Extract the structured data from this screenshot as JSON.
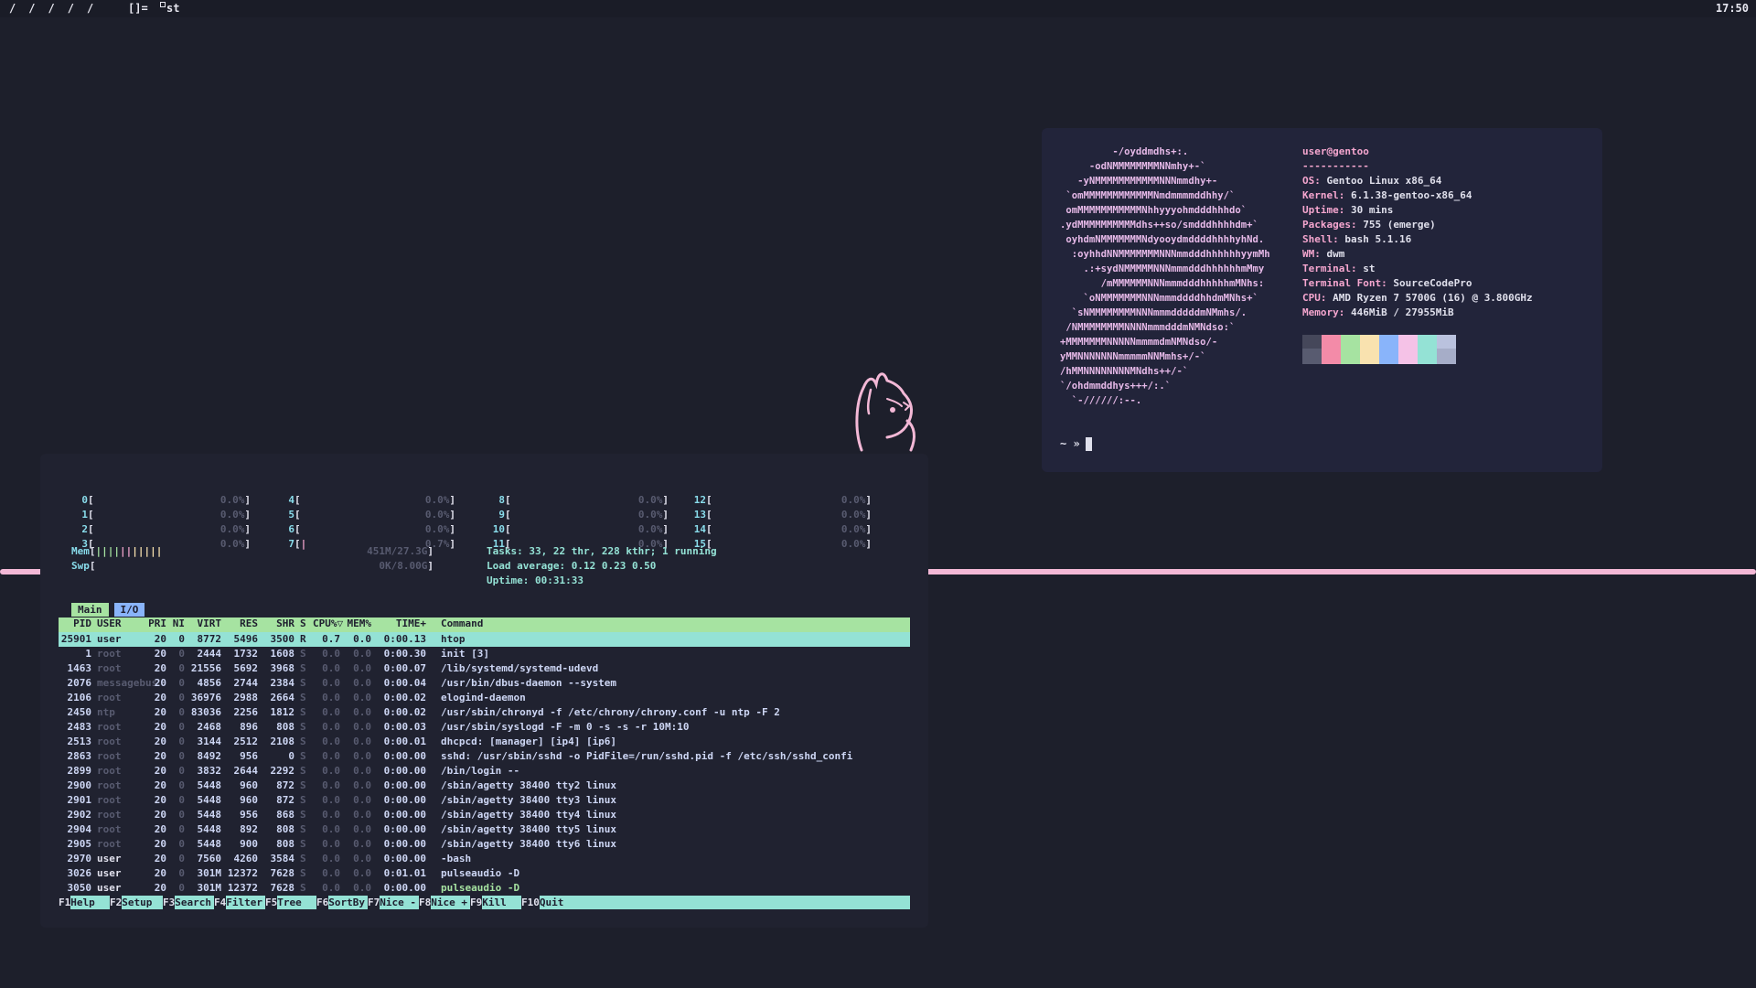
{
  "bar": {
    "tags": [
      "/",
      "/",
      "/",
      "/",
      "/"
    ],
    "layout": "[]=",
    "window_title": "st",
    "clock": "17:50"
  },
  "neofetch": {
    "ascii": [
      "         -/oyddmdhs+:.",
      "     -odNMMMMMMMMNNmhy+-`",
      "   -yNMMMMMMMMMMMNNNmmdhy+-",
      " `omMMMMMMMMMMMMNmdmmmmddhhy/`",
      " omMMMMMMMMMMMNhhyyyohmdddhhhdo`",
      ".ydMMMMMMMMMMdhs++so/smdddhhhhdm+`",
      " oyhdmNMMMMMMMNdyooydmddddhhhhyhNd.",
      "  :oyhhdNNMMMMMMMNNNmmdddhhhhhhyymMh",
      "    .:+sydNMMMMMNNNmmmdddhhhhhhmMmy",
      "       /mMMMMMMNNNmmmdddhhhhhmMNhs:",
      "    `oNMMMMMMMNNNmmmddddhhdmMNhs+`",
      "  `sNMMMMMMMMNNNmmmdddddmNMmhs/.",
      " /NMMMMMMMMNNNNmmmdddmNMNdso:`",
      "+MMMMMMMNNNNNmmmmdmNMNdso/-",
      "yMMNNNNNNNmmmmmNNMmhs+/-`",
      "/hMMNNNNNNNNMNdhs++/-`",
      "`/ohdmmddhys+++/:.`",
      "  `-//////:--."
    ],
    "info": [
      {
        "key": "user@gentoo",
        "value": ""
      },
      {
        "key": "-----------",
        "value": ""
      },
      {
        "key": "OS: ",
        "value": "Gentoo Linux x86_64"
      },
      {
        "key": "Kernel: ",
        "value": "6.1.38-gentoo-x86_64"
      },
      {
        "key": "Uptime: ",
        "value": "30 mins"
      },
      {
        "key": "Packages: ",
        "value": "755 (emerge)"
      },
      {
        "key": "Shell: ",
        "value": "bash 5.1.16"
      },
      {
        "key": "WM: ",
        "value": "dwm"
      },
      {
        "key": "Terminal: ",
        "value": "st"
      },
      {
        "key": "Terminal Font: ",
        "value": "SourceCodePro"
      },
      {
        "key": "CPU: ",
        "value": "AMD Ryzen 7 5700G (16) @ 3.800GHz"
      },
      {
        "key": "Memory: ",
        "value": "446MiB / 27955MiB"
      }
    ],
    "palette": [
      {
        "top": "#45475a",
        "bottom": "#585b70"
      },
      {
        "top": "#f38ba8",
        "bottom": "#f38ba8"
      },
      {
        "top": "#a6e3a1",
        "bottom": "#a6e3a1"
      },
      {
        "top": "#f9e2af",
        "bottom": "#f9e2af"
      },
      {
        "top": "#89b4fa",
        "bottom": "#89b4fa"
      },
      {
        "top": "#f5c2e7",
        "bottom": "#f5c2e7"
      },
      {
        "top": "#94e2d5",
        "bottom": "#94e2d5"
      },
      {
        "top": "#bac2de",
        "bottom": "#a6adc8"
      }
    ],
    "prompt": "~ »"
  },
  "htop": {
    "cpus": [
      {
        "id": "0",
        "pct": "0.0%"
      },
      {
        "id": "1",
        "pct": "0.0%"
      },
      {
        "id": "2",
        "pct": "0.0%"
      },
      {
        "id": "3",
        "pct": "0.0%"
      },
      {
        "id": "4",
        "pct": "0.0%"
      },
      {
        "id": "5",
        "pct": "0.0%"
      },
      {
        "id": "6",
        "pct": "0.0%"
      },
      {
        "id": "7",
        "pct": "0.7%"
      },
      {
        "id": "8",
        "pct": "0.0%"
      },
      {
        "id": "9",
        "pct": "0.0%"
      },
      {
        "id": "10",
        "pct": "0.0%"
      },
      {
        "id": "11",
        "pct": "0.0%"
      },
      {
        "id": "12",
        "pct": "0.0%"
      },
      {
        "id": "13",
        "pct": "0.0%"
      },
      {
        "id": "14",
        "pct": "0.0%"
      },
      {
        "id": "15",
        "pct": "0.0%"
      }
    ],
    "mem_label": "Mem",
    "mem_value": "451M/27.3G",
    "swp_label": "Swp",
    "swp_value": "0K/8.00G",
    "tasks": "Tasks: 33, 22 thr, 228 kthr; 1 running",
    "load": "Load average: 0.12 0.23 0.50",
    "uptime": "Uptime: 00:31:33",
    "tab_main": "Main",
    "tab_io": "I/O",
    "columns": [
      "PID",
      "USER",
      "PRI",
      "NI",
      "VIRT",
      "RES",
      "SHR",
      "S",
      "CPU%▽",
      "MEM%",
      "TIME+",
      "Command"
    ],
    "processes": [
      {
        "pid": "25901",
        "user": "user",
        "pri": "20",
        "ni": "0",
        "virt": "8772",
        "res": "5496",
        "shr": "3500",
        "s": "R",
        "cpu": "0.7",
        "mem": "0.0",
        "time": "0:00.13",
        "cmd": "htop"
      },
      {
        "pid": "1",
        "user": "root",
        "pri": "20",
        "ni": "0",
        "virt": "2444",
        "res": "1732",
        "shr": "1608",
        "s": "S",
        "cpu": "0.0",
        "mem": "0.0",
        "time": "0:00.30",
        "cmd": "init [3]"
      },
      {
        "pid": "1463",
        "user": "root",
        "pri": "20",
        "ni": "0",
        "virt": "21556",
        "res": "5692",
        "shr": "3968",
        "s": "S",
        "cpu": "0.0",
        "mem": "0.0",
        "time": "0:00.07",
        "cmd": "/lib/systemd/systemd-udevd"
      },
      {
        "pid": "2076",
        "user": "messagebus",
        "pri": "20",
        "ni": "0",
        "virt": "4856",
        "res": "2744",
        "shr": "2384",
        "s": "S",
        "cpu": "0.0",
        "mem": "0.0",
        "time": "0:00.04",
        "cmd": "/usr/bin/dbus-daemon --system"
      },
      {
        "pid": "2106",
        "user": "root",
        "pri": "20",
        "ni": "0",
        "virt": "36976",
        "res": "2988",
        "shr": "2664",
        "s": "S",
        "cpu": "0.0",
        "mem": "0.0",
        "time": "0:00.02",
        "cmd": "elogind-daemon"
      },
      {
        "pid": "2450",
        "user": "ntp",
        "pri": "20",
        "ni": "0",
        "virt": "83036",
        "res": "2256",
        "shr": "1812",
        "s": "S",
        "cpu": "0.0",
        "mem": "0.0",
        "time": "0:00.02",
        "cmd": "/usr/sbin/chronyd -f /etc/chrony/chrony.conf -u ntp -F 2"
      },
      {
        "pid": "2483",
        "user": "root",
        "pri": "20",
        "ni": "0",
        "virt": "2468",
        "res": "896",
        "shr": "808",
        "s": "S",
        "cpu": "0.0",
        "mem": "0.0",
        "time": "0:00.03",
        "cmd": "/usr/sbin/syslogd -F -m 0 -s -s -r 10M:10"
      },
      {
        "pid": "2513",
        "user": "root",
        "pri": "20",
        "ni": "0",
        "virt": "3144",
        "res": "2512",
        "shr": "2108",
        "s": "S",
        "cpu": "0.0",
        "mem": "0.0",
        "time": "0:00.01",
        "cmd": "dhcpcd: [manager] [ip4] [ip6]"
      },
      {
        "pid": "2863",
        "user": "root",
        "pri": "20",
        "ni": "0",
        "virt": "8492",
        "res": "956",
        "shr": "0",
        "s": "S",
        "cpu": "0.0",
        "mem": "0.0",
        "time": "0:00.00",
        "cmd": "sshd: /usr/sbin/sshd -o PidFile=/run/sshd.pid -f /etc/ssh/sshd_confi"
      },
      {
        "pid": "2899",
        "user": "root",
        "pri": "20",
        "ni": "0",
        "virt": "3832",
        "res": "2644",
        "shr": "2292",
        "s": "S",
        "cpu": "0.0",
        "mem": "0.0",
        "time": "0:00.00",
        "cmd": "/bin/login --"
      },
      {
        "pid": "2900",
        "user": "root",
        "pri": "20",
        "ni": "0",
        "virt": "5448",
        "res": "960",
        "shr": "872",
        "s": "S",
        "cpu": "0.0",
        "mem": "0.0",
        "time": "0:00.00",
        "cmd": "/sbin/agetty 38400 tty2 linux"
      },
      {
        "pid": "2901",
        "user": "root",
        "pri": "20",
        "ni": "0",
        "virt": "5448",
        "res": "960",
        "shr": "872",
        "s": "S",
        "cpu": "0.0",
        "mem": "0.0",
        "time": "0:00.00",
        "cmd": "/sbin/agetty 38400 tty3 linux"
      },
      {
        "pid": "2902",
        "user": "root",
        "pri": "20",
        "ni": "0",
        "virt": "5448",
        "res": "956",
        "shr": "868",
        "s": "S",
        "cpu": "0.0",
        "mem": "0.0",
        "time": "0:00.00",
        "cmd": "/sbin/agetty 38400 tty4 linux"
      },
      {
        "pid": "2904",
        "user": "root",
        "pri": "20",
        "ni": "0",
        "virt": "5448",
        "res": "892",
        "shr": "808",
        "s": "S",
        "cpu": "0.0",
        "mem": "0.0",
        "time": "0:00.00",
        "cmd": "/sbin/agetty 38400 tty5 linux"
      },
      {
        "pid": "2905",
        "user": "root",
        "pri": "20",
        "ni": "0",
        "virt": "5448",
        "res": "900",
        "shr": "808",
        "s": "S",
        "cpu": "0.0",
        "mem": "0.0",
        "time": "0:00.00",
        "cmd": "/sbin/agetty 38400 tty6 linux"
      },
      {
        "pid": "2970",
        "user": "user",
        "pri": "20",
        "ni": "0",
        "virt": "7560",
        "res": "4260",
        "shr": "3584",
        "s": "S",
        "cpu": "0.0",
        "mem": "0.0",
        "time": "0:00.00",
        "cmd": "-bash"
      },
      {
        "pid": "3026",
        "user": "user",
        "pri": "20",
        "ni": "0",
        "virt": "301M",
        "res": "12372",
        "shr": "7628",
        "s": "S",
        "cpu": "0.0",
        "mem": "0.0",
        "time": "0:01.01",
        "cmd": "pulseaudio -D"
      },
      {
        "pid": "3050",
        "user": "user",
        "pri": "20",
        "ni": "0",
        "virt": "301M",
        "res": "12372",
        "shr": "7628",
        "s": "S",
        "cpu": "0.0",
        "mem": "0.0",
        "time": "0:00.00",
        "cmd": "pulseaudio -D"
      }
    ],
    "fkeys": [
      {
        "key": "F1",
        "label": "Help"
      },
      {
        "key": "F2",
        "label": "Setup"
      },
      {
        "key": "F3",
        "label": "Search"
      },
      {
        "key": "F4",
        "label": "Filter"
      },
      {
        "key": "F5",
        "label": "Tree"
      },
      {
        "key": "F6",
        "label": "SortBy"
      },
      {
        "key": "F7",
        "label": "Nice -"
      },
      {
        "key": "F8",
        "label": "Nice +"
      },
      {
        "key": "F9",
        "label": "Kill"
      },
      {
        "key": "F10",
        "label": "Quit"
      }
    ]
  }
}
